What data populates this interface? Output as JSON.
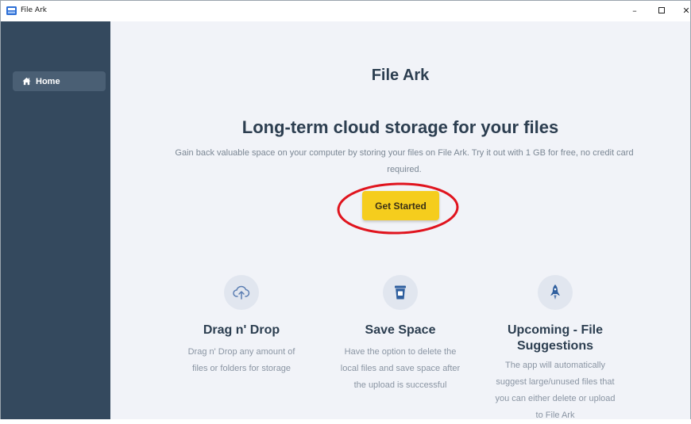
{
  "window": {
    "title": "File Ark",
    "controls": {
      "minimize": "–",
      "maximize": "□",
      "close": "✕"
    }
  },
  "sidebar": {
    "items": [
      {
        "label": "Home",
        "icon": "home-icon",
        "active": true
      }
    ]
  },
  "main": {
    "app_name": "File Ark",
    "headline": "Long-term cloud storage for your files",
    "subtext": "Gain back valuable space on your computer by storing your files on File Ark. Try it out with 1 GB for free, no credit card required.",
    "cta_label": "Get Started",
    "features": [
      {
        "icon": "cloud-upload-icon",
        "title": "Drag n' Drop",
        "description": "Drag n' Drop any amount of files or folders for storage"
      },
      {
        "icon": "trash-can-icon",
        "title": "Save Space",
        "description": "Have the option to delete the local files and save space after the upload is successful"
      },
      {
        "icon": "rocket-icon",
        "title": "Upcoming - File Suggestions",
        "description": "The app will automatically suggest large/unused files that you can either delete or upload to File Ark"
      }
    ]
  },
  "colors": {
    "sidebar_bg": "#34495e",
    "main_bg": "#f1f3f8",
    "accent_button": "#f5cd1d",
    "heading_text": "#2c3e50",
    "muted_text": "#7b8794",
    "highlight_ring": "#e0141e"
  }
}
